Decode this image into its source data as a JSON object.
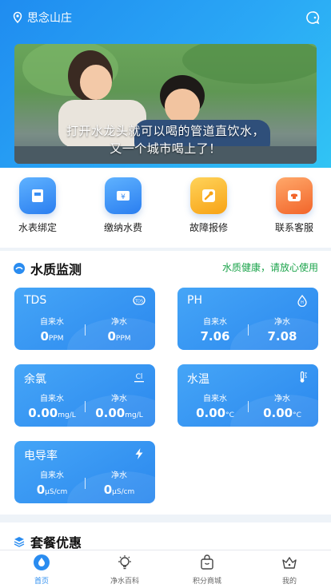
{
  "header": {
    "location": "思念山庄"
  },
  "banner": {
    "line1": "打开水龙头就可以喝的管道直饮水，",
    "line2": "又一个城市喝上了！"
  },
  "services": [
    {
      "label": "水表绑定",
      "icon": "meter-icon"
    },
    {
      "label": "缴纳水费",
      "icon": "payment-icon"
    },
    {
      "label": "故障报修",
      "icon": "wrench-icon"
    },
    {
      "label": "联系客服",
      "icon": "phone-icon"
    }
  ],
  "quality": {
    "title": "水质监测",
    "status": "水质健康，请放心使用",
    "cards": [
      {
        "name": "TDS",
        "tap_label": "自来水",
        "tap_value": "0",
        "tap_unit": "PPM",
        "pure_label": "净水",
        "pure_value": "0",
        "pure_unit": "PPM",
        "icon": "tds-icon"
      },
      {
        "name": "PH",
        "tap_label": "自来水",
        "tap_value": "7.06",
        "tap_unit": "",
        "pure_label": "净水",
        "pure_value": "7.08",
        "pure_unit": "",
        "icon": "ph-icon"
      },
      {
        "name": "余氯",
        "tap_label": "自来水",
        "tap_value": "0.00",
        "tap_unit": "mg/L",
        "pure_label": "净水",
        "pure_value": "0.00",
        "pure_unit": "mg/L",
        "icon": "chlorine-icon"
      },
      {
        "name": "水温",
        "tap_label": "自来水",
        "tap_value": "0.00",
        "tap_unit": "°C",
        "pure_label": "净水",
        "pure_value": "0.00",
        "pure_unit": "°C",
        "icon": "thermometer-icon"
      },
      {
        "name": "电导率",
        "tap_label": "自来水",
        "tap_value": "0",
        "tap_unit": "μS/cm",
        "pure_label": "净水",
        "pure_value": "0",
        "pure_unit": "μS/cm",
        "icon": "lightning-icon"
      }
    ]
  },
  "package": {
    "title": "套餐优惠"
  },
  "tabs": [
    {
      "label": "首页",
      "icon": "water-drop-icon",
      "active": true
    },
    {
      "label": "净水百科",
      "icon": "bulb-icon",
      "active": false
    },
    {
      "label": "积分商城",
      "icon": "shopping-bag-icon",
      "active": false
    },
    {
      "label": "我的",
      "icon": "crown-icon",
      "active": false
    }
  ],
  "colors": {
    "accent": "#2a8cf0",
    "status_green": "#1aa34a"
  }
}
